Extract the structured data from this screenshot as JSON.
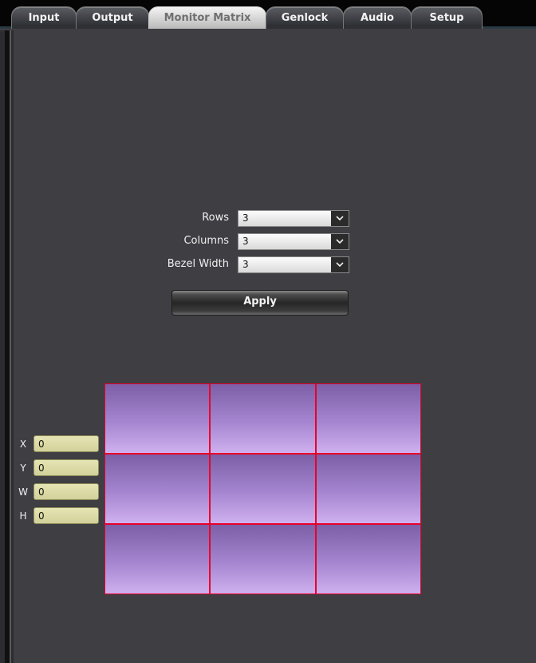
{
  "tabs": [
    {
      "label": "Input",
      "active": false
    },
    {
      "label": "Output",
      "active": false
    },
    {
      "label": "Monitor Matrix",
      "active": true
    },
    {
      "label": "Genlock",
      "active": false
    },
    {
      "label": "Audio",
      "active": false
    },
    {
      "label": "Setup",
      "active": false
    }
  ],
  "form": {
    "rows_label": "Rows",
    "rows_value": "3",
    "columns_label": "Columns",
    "columns_value": "3",
    "bezel_label": "Bezel Width",
    "bezel_value": "3",
    "apply_label": "Apply"
  },
  "coords": [
    {
      "label": "X",
      "value": "0"
    },
    {
      "label": "Y",
      "value": "0"
    },
    {
      "label": "W",
      "value": "0"
    },
    {
      "label": "H",
      "value": "0"
    }
  ],
  "matrix": {
    "rows": 3,
    "columns": 3,
    "cell_border_color": "#e8002a",
    "cell_fill_top": "#7c5fa7",
    "cell_fill_bottom": "#cfb0ef"
  },
  "colors": {
    "background": "#3f3e43",
    "active_tab": "#e8e8e8",
    "inactive_tab": "#3c3e42"
  }
}
